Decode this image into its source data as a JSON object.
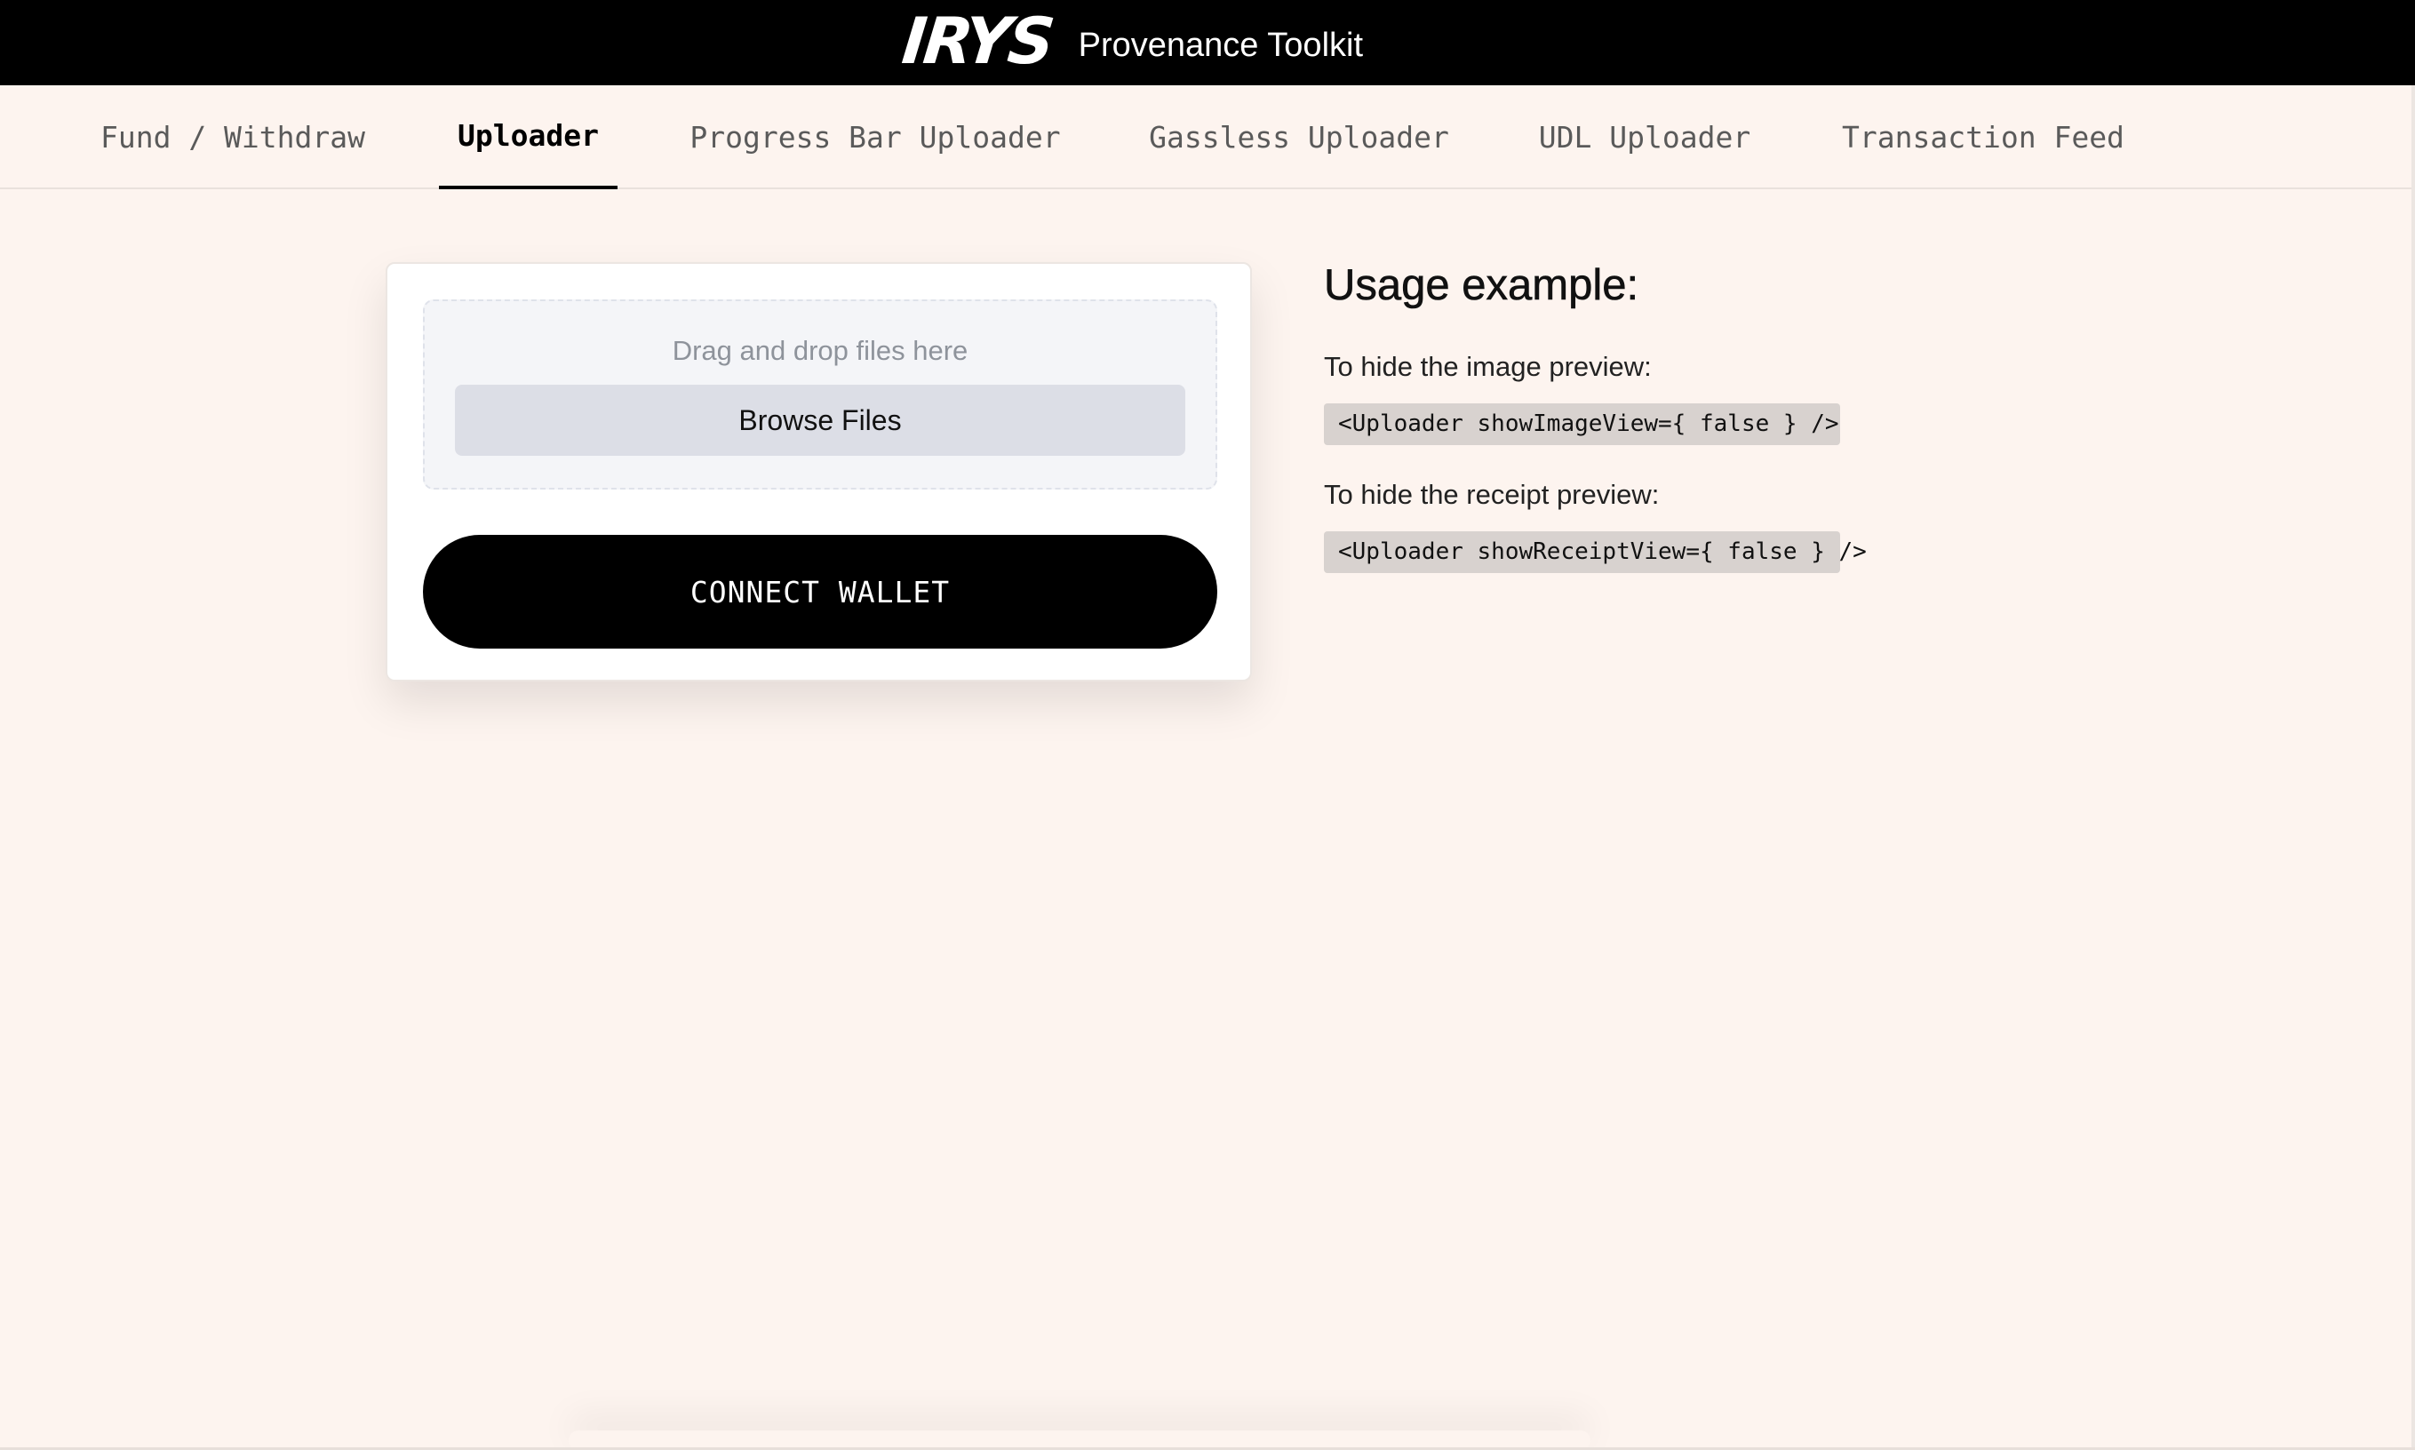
{
  "header": {
    "logo_text": "IRYS",
    "title": "Provenance Toolkit"
  },
  "tabs": [
    {
      "label": "Fund / Withdraw",
      "active": false
    },
    {
      "label": "Uploader",
      "active": true
    },
    {
      "label": "Progress Bar Uploader",
      "active": false
    },
    {
      "label": "Gassless Uploader",
      "active": false
    },
    {
      "label": "UDL Uploader",
      "active": false
    },
    {
      "label": "Transaction Feed",
      "active": false
    }
  ],
  "uploader": {
    "drop_text": "Drag and drop files here",
    "browse_label": "Browse Files",
    "connect_label": "CONNECT WALLET"
  },
  "usage": {
    "title": "Usage example:",
    "items": [
      {
        "description": "To hide the image preview:",
        "code": "<Uploader showImageView={ false } />"
      },
      {
        "description": "To hide the receipt preview:",
        "code": "<Uploader showReceiptView={ false } />"
      }
    ]
  },
  "colors": {
    "background": "#fdf4ef",
    "header": "#000000",
    "accent": "#000000",
    "code_bg": "#d8d2cf"
  }
}
